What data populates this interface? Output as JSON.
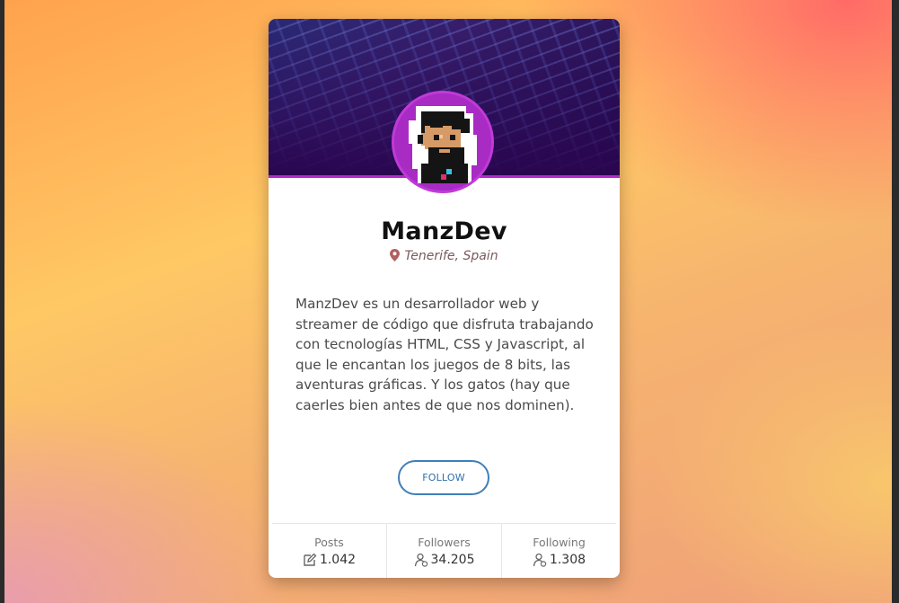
{
  "colors": {
    "accent": "#b428c9",
    "follow_button": "#3f7fb8",
    "name_text": "#111111",
    "location_text": "#7a5a5a",
    "pin_icon": "#b06060"
  },
  "profile": {
    "name": "ManzDev",
    "location": "Tenerife, Spain",
    "location_icon": "map-pin-icon",
    "bio": "ManzDev es un desarrollador web y streamer de código que disfruta trabajando con tecnologías HTML, CSS y Javascript, al que le encantan los juegos de 8 bits, las aventuras gráficas. Y los gatos (hay que caerles bien antes de que nos dominen).",
    "follow_label": "FOLLOW"
  },
  "stats": [
    {
      "label": "Posts",
      "value": "1.042",
      "icon": "edit-icon"
    },
    {
      "label": "Followers",
      "value": "34.205",
      "icon": "user-icon"
    },
    {
      "label": "Following",
      "value": "1.308",
      "icon": "user-icon"
    }
  ]
}
